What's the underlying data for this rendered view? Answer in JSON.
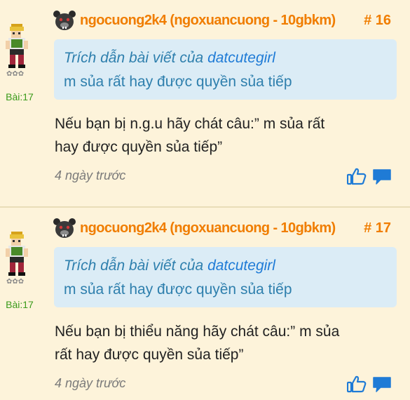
{
  "posts": [
    {
      "username": "ngocuong2k4 (ngoxuancuong - 10gbkm)",
      "post_number": "# 16",
      "post_count": "Bài:17",
      "quote": {
        "prefix": "Trích dẫn bài viết của",
        "author": "datcutegirl",
        "text": "m sủa rất hay được quyền sủa tiếp"
      },
      "content_lines": [
        "Nếu bạn bị n.g.u hãy chát câu:” m sủa rất",
        "hay được quyền sủa tiếp”"
      ],
      "timestamp": "4 ngày trước"
    },
    {
      "username": "ngocuong2k4 (ngoxuancuong - 10gbkm)",
      "post_number": "# 17",
      "post_count": "Bài:17",
      "quote": {
        "prefix": "Trích dẫn bài viết của",
        "author": "datcutegirl",
        "text": "m sủa rất hay được quyền sủa tiếp"
      },
      "content_lines": [
        "Nếu bạn bị thiểu năng hãy chát câu:” m sủa",
        "rất hay được quyền sủa tiếp”"
      ],
      "timestamp": "4 ngày trước"
    }
  ],
  "colors": {
    "background": "#fdf3da",
    "username": "#f07d00",
    "quote_bg": "#dbecf6",
    "quote_text": "#2e7fad",
    "post_count": "#3a9a1a",
    "action_icons": "#1f7bd6"
  },
  "icons": {
    "user_icon": "dark-bear-face-icon",
    "like": "thumbs-up-icon",
    "reply": "speech-bubble-icon",
    "avatar": "pixel-character-avatar"
  }
}
